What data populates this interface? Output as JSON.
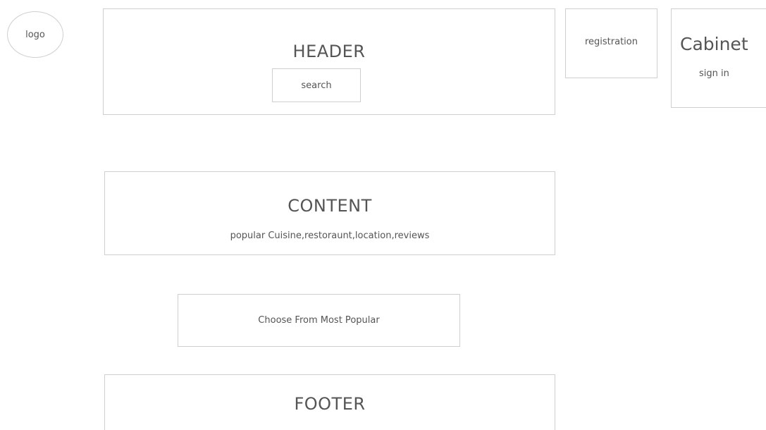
{
  "logo": {
    "label": "logo"
  },
  "header": {
    "title": "HEADER",
    "search_label": "search"
  },
  "registration": {
    "label": "registration"
  },
  "cabinet": {
    "title": "Cabinet",
    "sign_in_label": "sign in"
  },
  "content": {
    "title": "CONTENT",
    "subtitle": "popular  Cuisine,restoraunt,location,reviews"
  },
  "choose": {
    "label": "Choose From Most Popular"
  },
  "footer": {
    "title": "FOOTER"
  }
}
